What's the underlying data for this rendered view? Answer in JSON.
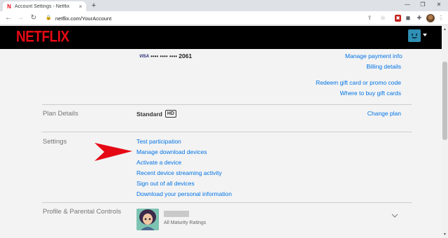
{
  "browser": {
    "tab_title": "Account Settings - Netflix",
    "tab_favicon": "N",
    "tab_close": "×",
    "new_tab": "+",
    "url": "netflix.com/YourAccount",
    "window_controls": [
      "—",
      "❐",
      "✕"
    ]
  },
  "netflix": {
    "logo": "NETFLIX"
  },
  "payment": {
    "card_brand": "VISA",
    "card_mask": "•••• •••• ••••",
    "card_last4": "2061",
    "manage_payment": "Manage payment info",
    "billing_details": "Billing details",
    "redeem": "Redeem gift card or promo code",
    "where_to_buy": "Where to buy gift cards"
  },
  "plan": {
    "label": "Plan Details",
    "value": "Standard",
    "badge": "HD",
    "change": "Change plan"
  },
  "settings": {
    "label": "Settings",
    "links": [
      "Test participation",
      "Manage download devices",
      "Activate a device",
      "Recent device streaming activity",
      "Sign out of all devices",
      "Download your personal information"
    ]
  },
  "profiles": {
    "label": "Profile & Parental Controls",
    "maturity": "All Maturity Ratings"
  },
  "colors": {
    "netflix_red": "#e50914",
    "link_blue": "#0073e6",
    "arrow_red": "#e50914"
  },
  "icons": [
    "netflix-favicon-icon",
    "back-arrow-icon",
    "forward-arrow-icon",
    "reload-icon",
    "lock-icon",
    "share-icon",
    "bookmark-star-icon",
    "extension-icon",
    "puzzle-icon",
    "profile-icon",
    "chevron-down-icon",
    "red-arrow-icon"
  ]
}
